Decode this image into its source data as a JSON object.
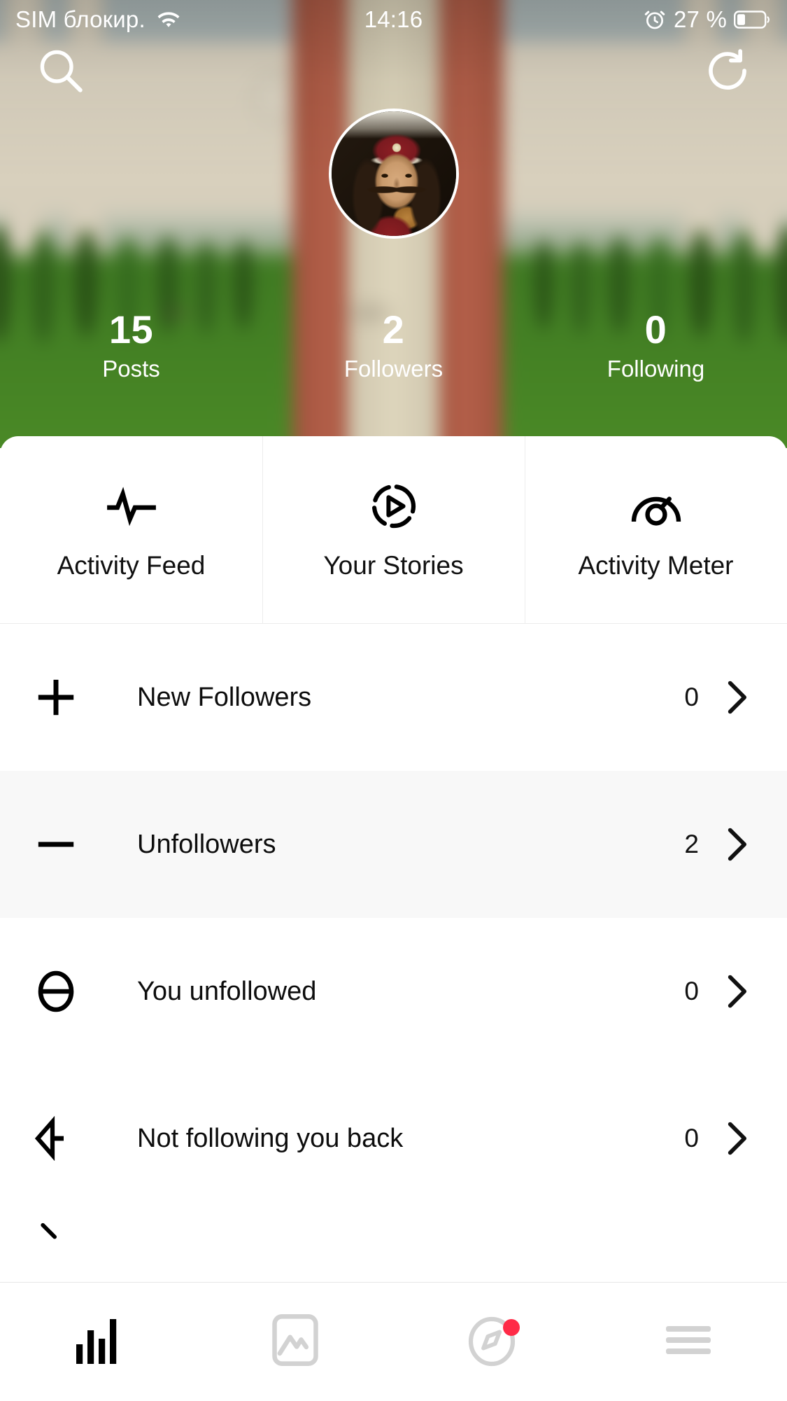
{
  "statusbar": {
    "carrier": "SIM блокир.",
    "wifi_icon": "wifi-icon",
    "time": "14:16",
    "alarm_icon": "alarm-icon",
    "battery_percent": "27 %",
    "battery_icon": "battery-icon"
  },
  "header": {
    "search_icon": "search-icon",
    "refresh_icon": "refresh-icon"
  },
  "profile": {
    "avatar_name": "profile-avatar",
    "stats": [
      {
        "value": "15",
        "label": "Posts"
      },
      {
        "value": "2",
        "label": "Followers"
      },
      {
        "value": "0",
        "label": "Following"
      }
    ]
  },
  "tabs": [
    {
      "label": "Activity Feed",
      "icon": "pulse-icon"
    },
    {
      "label": "Your Stories",
      "icon": "story-play-icon"
    },
    {
      "label": "Activity Meter",
      "icon": "gauge-icon"
    }
  ],
  "list": [
    {
      "label": "New Followers",
      "count": "0",
      "icon": "plus-icon",
      "shaded": false
    },
    {
      "label": "Unfollowers",
      "count": "2",
      "icon": "minus-icon",
      "shaded": true
    },
    {
      "label": "You unfollowed",
      "count": "0",
      "icon": "no-entry-icon",
      "shaded": false
    },
    {
      "label": "Not following you back",
      "count": "0",
      "icon": "arrow-left-icon",
      "shaded": false
    }
  ],
  "bottom_nav": [
    {
      "icon": "bar-chart-icon",
      "active": true,
      "badge": false
    },
    {
      "icon": "chart-frame-icon",
      "active": false,
      "badge": false
    },
    {
      "icon": "compass-icon",
      "active": false,
      "badge": true
    },
    {
      "icon": "menu-icon",
      "active": false,
      "badge": false
    }
  ],
  "colors": {
    "active_nav": "#000000",
    "inactive_nav": "#d2d2d2",
    "badge": "#ff2b47",
    "shaded_row": "#f8f8f8",
    "text_primary": "#0d0d0d",
    "card_bg": "#ffffff"
  }
}
